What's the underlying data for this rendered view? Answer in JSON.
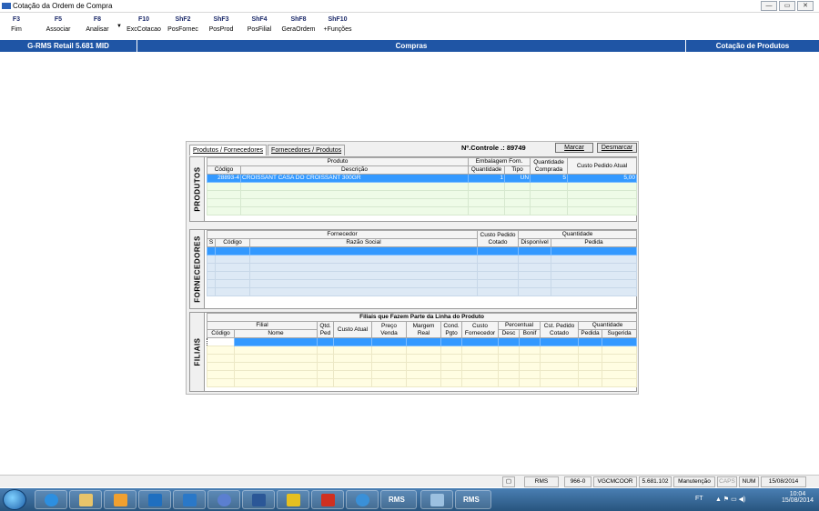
{
  "window": {
    "title": "Cotação da Ordem de Compra"
  },
  "toolbar": [
    {
      "key": "F3",
      "label": "Fim"
    },
    {
      "key": "F5",
      "label": "Associar"
    },
    {
      "key": "F8",
      "label": "Analisar"
    },
    {
      "key": "F10",
      "label": "ExcCotacao"
    },
    {
      "key": "ShF2",
      "label": "PosFornec"
    },
    {
      "key": "ShF3",
      "label": "PosProd"
    },
    {
      "key": "ShF4",
      "label": "PosFilial"
    },
    {
      "key": "ShF8",
      "label": "GeraOrdem"
    },
    {
      "key": "ShF10",
      "label": "+Funções"
    }
  ],
  "navbar": {
    "left": "G-RMS Retail 5.681 MID",
    "center": "Compras",
    "right": "Cotação de Produtos"
  },
  "dialog": {
    "tabs": [
      "Produtos / Fornecedores",
      "Fornecedores / Produtos"
    ],
    "controle": "Nº.Controle .: 89749",
    "marcar": "Marcar",
    "desmarcar": "Desmarcar"
  },
  "produtos": {
    "label": "PRODUTOS",
    "h_produto": "Produto",
    "h_embalagem": "Embalagem Forn.",
    "h_qtd_comprada": "Quantidade Comprada",
    "h_custo": "Custo Pedido Atual",
    "h_codigo": "Código",
    "h_descricao": "Descrição",
    "h_quantidade": "Quantidade",
    "h_tipo": "Tipo",
    "row": {
      "codigo": "28893-4",
      "descricao": "CROISSANT CASA DO CROISSANT 300GR",
      "quantidade": "1",
      "tipo": "UN",
      "comprada": "5",
      "custo": "5,00"
    }
  },
  "fornecedores": {
    "label": "FORNECEDORES",
    "h_fornecedor": "Fornecedor",
    "h_custo": "Custo Pedido Cotado",
    "h_quantidade": "Quantidade",
    "h_s": "S",
    "h_codigo": "Código",
    "h_razao": "Razão Social",
    "h_disponivel": "Disponível",
    "h_pedida": "Pedida"
  },
  "filiais": {
    "label": "FILIAIS",
    "title": "Filiais que Fazem Parte da Linha do Produto",
    "h_filial": "Filial",
    "h_qtd_ped": "Qtd. Ped",
    "h_custo_atual": "Custo Atual",
    "h_preco_venda": "Preço Venda",
    "h_margem": "Margem Real",
    "h_cond": "Cond. Pgto",
    "h_custo_forn": "Custo Fornecedor",
    "h_percentual": "Percentual",
    "h_cst_pedido": "Cst. Pedido Cotado",
    "h_quantidade": "Quantidade",
    "h_codigo": "Código",
    "h_nome": "Nome",
    "h_desc": "Desc",
    "h_bonif": "Bonif",
    "h_pedida": "Pedida",
    "h_sugerida": "Sugerida"
  },
  "statusbar": [
    "RMS",
    "966-0",
    "VGCMCOOR",
    "5.681.102",
    "Manutenção",
    "CAPS",
    "NUM",
    "15/08/2014"
  ],
  "taskbar": {
    "lang": "FT",
    "time": "10:04",
    "date": "15/08/2014",
    "apps": [
      "ie-icon",
      "explorer-icon",
      "media-icon",
      "outlook-icon",
      "lync-icon",
      "link-icon",
      "word-icon",
      "calc-icon",
      "pdf-icon",
      "globe-icon",
      "rms-icon",
      "window-icon",
      "rms-icon"
    ],
    "app_text": [
      "RMS",
      "RMS"
    ]
  }
}
